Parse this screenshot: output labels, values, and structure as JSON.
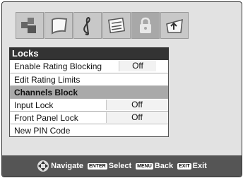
{
  "icon_tabs": [
    {
      "name": "picture-icon"
    },
    {
      "name": "screen-icon"
    },
    {
      "name": "audio-icon"
    },
    {
      "name": "setup-icon"
    },
    {
      "name": "lock-icon"
    },
    {
      "name": "applications-icon"
    }
  ],
  "panel": {
    "title": "Locks",
    "items": [
      {
        "label": "Enable Rating Blocking",
        "value": "Off"
      },
      {
        "label": "Edit Rating Limits",
        "value": ""
      },
      {
        "label": "Channels Block",
        "value": ""
      },
      {
        "label": "Input Lock",
        "value": "Off"
      },
      {
        "label": "Front Panel Lock",
        "value": "Off"
      },
      {
        "label": "New PIN Code",
        "value": ""
      }
    ]
  },
  "footer": {
    "navigate_label": "Navigate",
    "enter_key": "ENTER",
    "select_label": "Select",
    "menu_key": "MENU",
    "back_label": "Back",
    "exit_key": "EXIT",
    "exit_label": "Exit"
  }
}
